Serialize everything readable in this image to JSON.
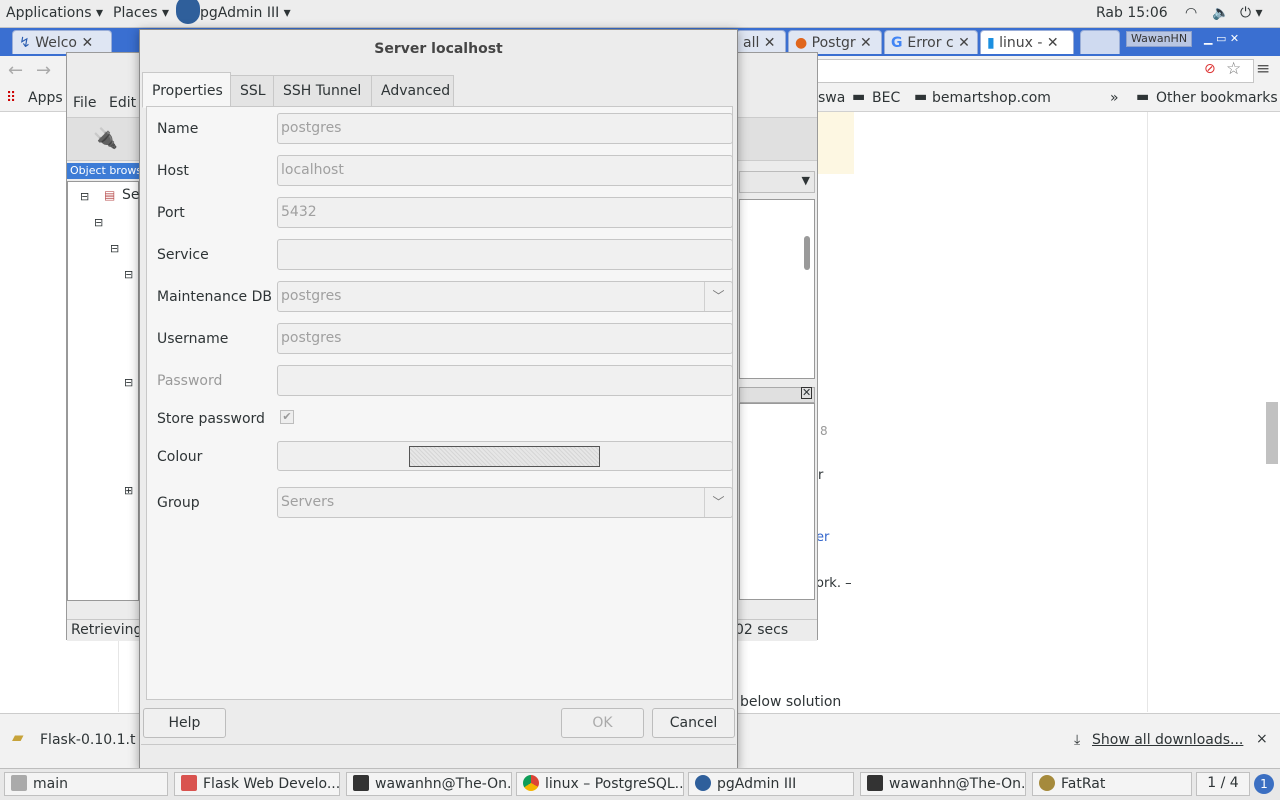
{
  "top_panel": {
    "applications": "Applications",
    "places": "Places",
    "app_menu": "pgAdmin III",
    "clock": "Rab 15:06"
  },
  "browser": {
    "tabs": [
      "Welco",
      "Postgr",
      "Error c",
      "linux -",
      "all"
    ],
    "profile": "WawanHN",
    "bookmarks": {
      "apps": "Apps",
      "items": [
        "swa",
        "BEC",
        "bemartshop.com"
      ],
      "overflow": "»",
      "other": "Other bookmarks"
    },
    "page_fragments": [
      "8",
      "r",
      "er",
      "ork. –",
      "below solution"
    ]
  },
  "pgadmin": {
    "menu_file": "File",
    "menu_edit": "Edit",
    "object_browser": "Object brows",
    "status_left": "Retrieving",
    "status_right": "02 secs",
    "tree_root": "Se"
  },
  "dialog": {
    "title": "Server localhost",
    "tabs": [
      "Properties",
      "SSL",
      "SSH Tunnel",
      "Advanced"
    ],
    "fields": {
      "name_label": "Name",
      "name_value": "postgres",
      "host_label": "Host",
      "host_value": "localhost",
      "port_label": "Port",
      "port_value": "5432",
      "service_label": "Service",
      "service_value": "",
      "maintdb_label": "Maintenance DB",
      "maintdb_value": "postgres",
      "username_label": "Username",
      "username_value": "postgres",
      "password_label": "Password",
      "password_value": "",
      "storepw_label": "Store password",
      "colour_label": "Colour",
      "group_label": "Group",
      "group_value": "Servers"
    },
    "help": "Help",
    "ok": "OK",
    "cancel": "Cancel"
  },
  "downloads": {
    "file": "Flask-0.10.1.t",
    "show_all": "Show all downloads...",
    "close": "×"
  },
  "taskbar": {
    "items": [
      "main",
      "Flask Web Develo...",
      "wawanhn@The-On...",
      "linux – PostgreSQL...",
      "pgAdmin III",
      "wawanhn@The-On...",
      "FatRat"
    ],
    "workspace": "1 / 4",
    "notif": "1"
  }
}
